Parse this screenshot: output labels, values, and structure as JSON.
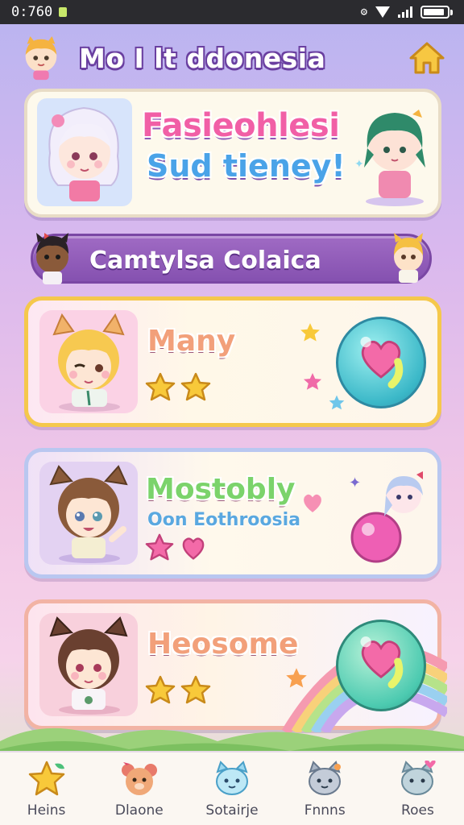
{
  "status_bar": {
    "time": "0:760"
  },
  "header": {
    "title": "Mo I lt ddonesia"
  },
  "hero": {
    "title_line1": "Fasieohlesi",
    "title_line2": "Sud tieney!"
  },
  "banner": {
    "label": "Camtylsa Colaica"
  },
  "levels": [
    {
      "name": "Many",
      "subtitle": "",
      "stars": 2,
      "reward": "heart-orb"
    },
    {
      "name": "Mostobly",
      "subtitle": "Oon Eothroosia",
      "stars": 2,
      "reward": "pink-orb"
    },
    {
      "name": "Heosome",
      "subtitle": "",
      "stars": 2,
      "reward": "heart-orb"
    }
  ],
  "bottom_nav": [
    {
      "label": "Heins",
      "icon": "star-icon"
    },
    {
      "label": "Dlaone",
      "icon": "bear-icon"
    },
    {
      "label": "Sotairje",
      "icon": "cat-icon"
    },
    {
      "label": "Fnnns",
      "icon": "cat-icon"
    },
    {
      "label": "Roes",
      "icon": "cat-heart-icon"
    }
  ],
  "colors": {
    "accent_purple": "#8551b0",
    "gold": "#f5c84c",
    "pink": "#f15fa6"
  }
}
